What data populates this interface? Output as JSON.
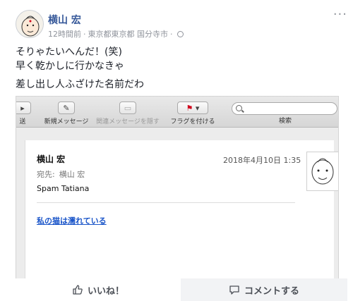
{
  "post": {
    "author": "横山 宏",
    "time": "12時間前",
    "location": "東京都東京都 国分寺市",
    "lines": [
      "そりゃたいへんだ！(笑)",
      "早く乾かしに行かなきゃ",
      "差し出し人ふざけた名前だわ"
    ]
  },
  "mail_toolbar": {
    "partial_label": "送",
    "new_message": "新規メッセージ",
    "related": "関連メッセージを隠す",
    "flag": "フラグを付ける",
    "search": "検索"
  },
  "mail": {
    "from": "横山 宏",
    "date": "2018年4月10日 1:35",
    "to_label": "宛先:",
    "to_name": "横山 宏",
    "subject": "Spam Tatiana",
    "body_link": "私の猫は濡れている"
  },
  "actions": {
    "like": "いいね！",
    "comment": "コメントする"
  },
  "colors": {
    "author": "#365899",
    "link": "#1a55c9",
    "flag": "#d0021b"
  }
}
